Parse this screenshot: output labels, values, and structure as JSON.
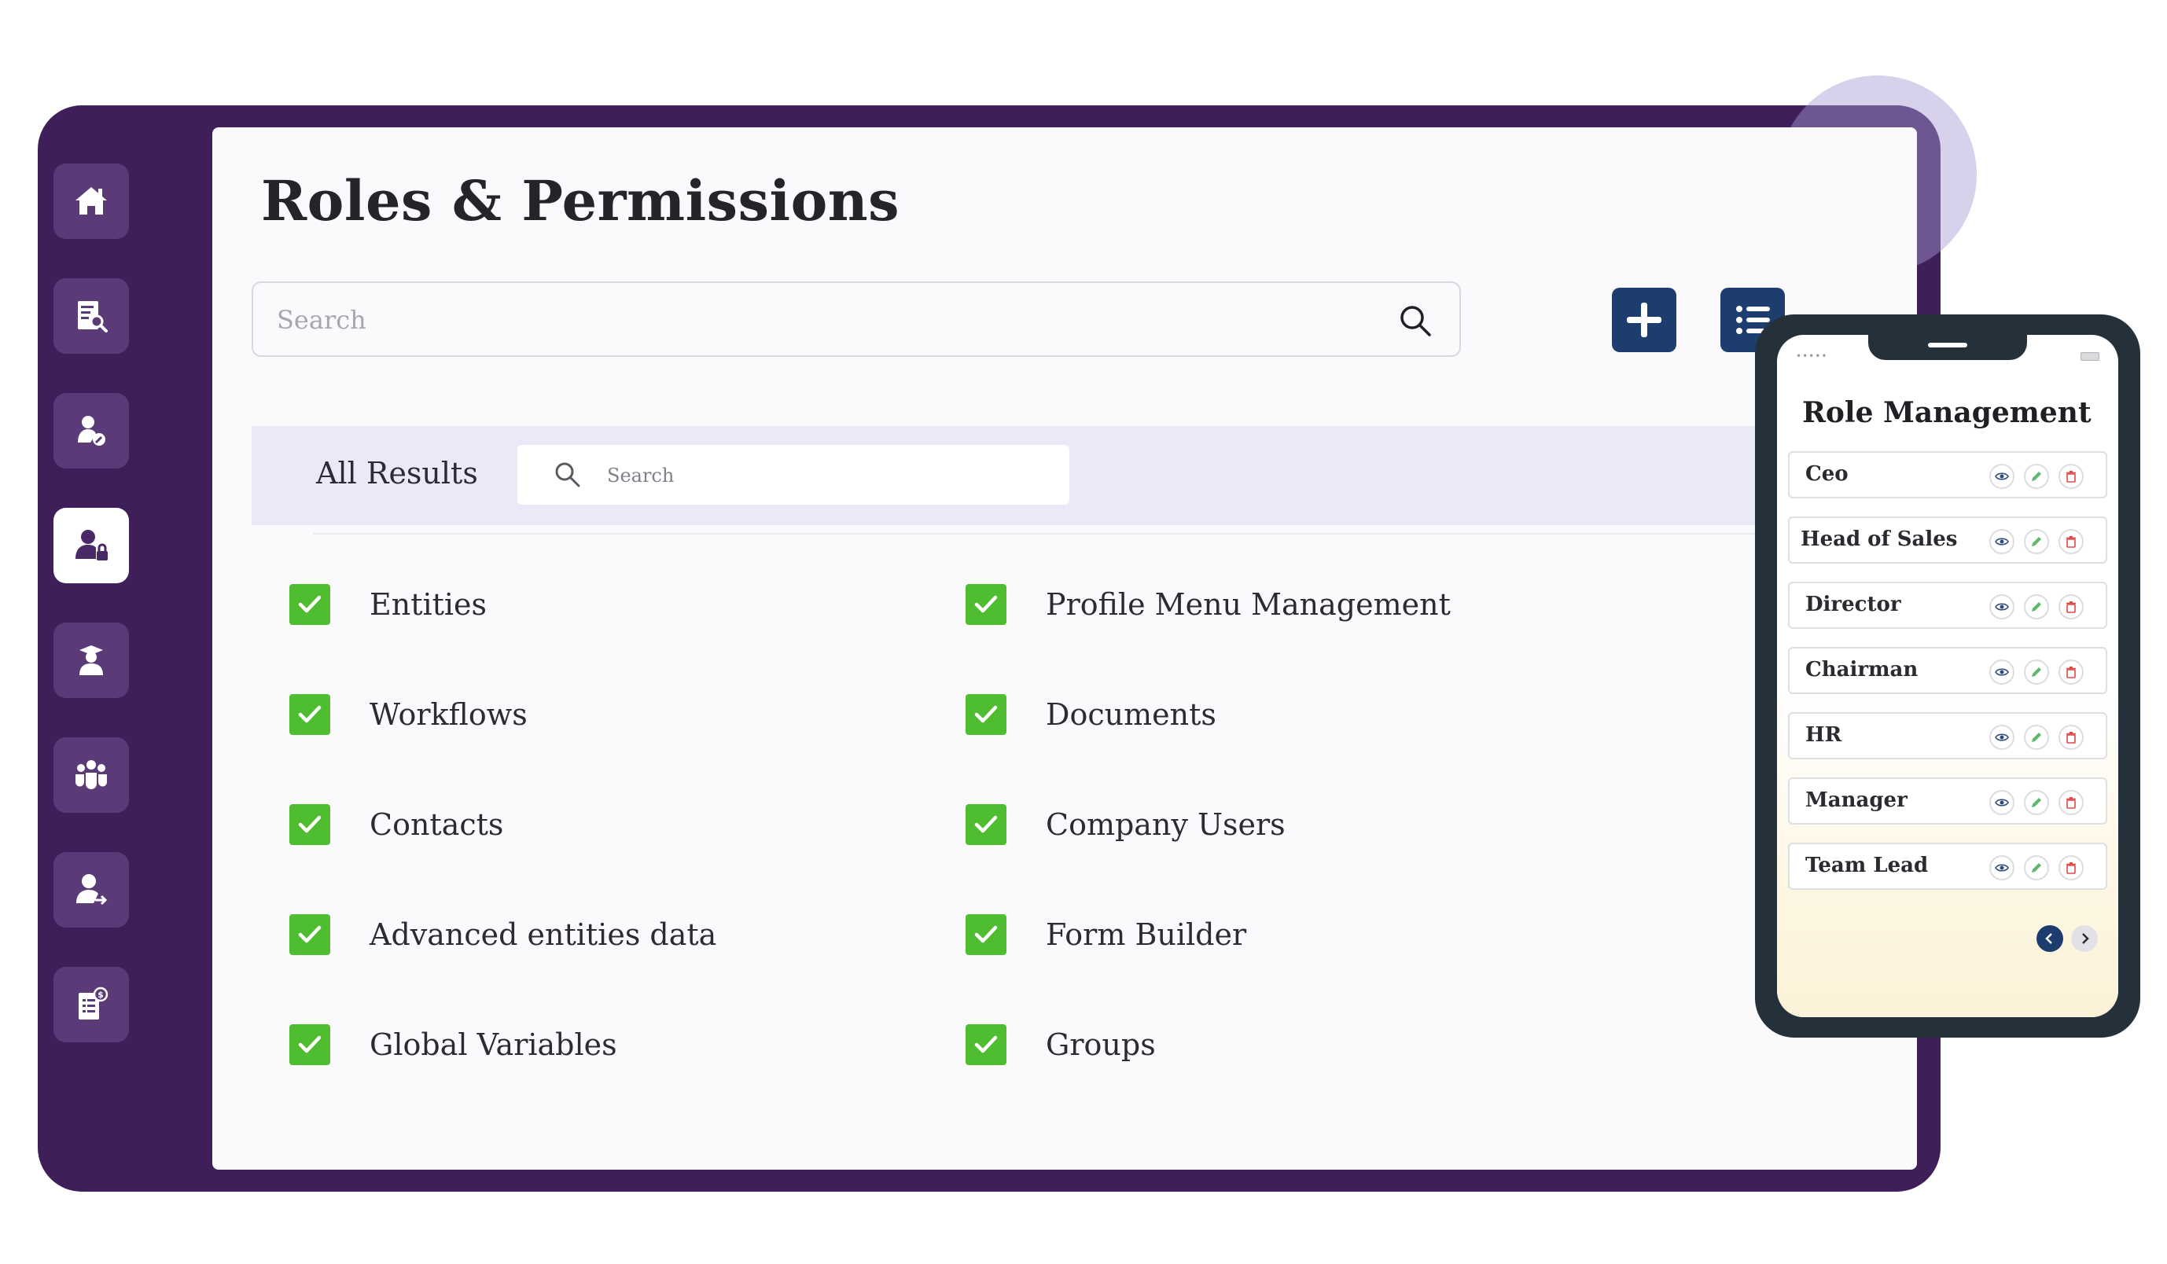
{
  "app": {
    "title": "Roles & Permissions"
  },
  "sidebar": {
    "items": [
      {
        "name": "home",
        "icon": "home-icon",
        "active": false
      },
      {
        "name": "document-search",
        "icon": "document-search-icon",
        "active": false
      },
      {
        "name": "user-settings",
        "icon": "user-edit-icon",
        "active": false
      },
      {
        "name": "user-permissions",
        "icon": "user-lock-icon",
        "active": true
      },
      {
        "name": "graduate",
        "icon": "graduate-icon",
        "active": false
      },
      {
        "name": "team",
        "icon": "team-icon",
        "active": false
      },
      {
        "name": "user-transfer",
        "icon": "user-arrow-icon",
        "active": false
      },
      {
        "name": "billing",
        "icon": "invoice-dollar-icon",
        "active": false
      }
    ]
  },
  "search": {
    "placeholder": "Search",
    "value": ""
  },
  "toolbar": {
    "add_icon": "plus-icon",
    "list_icon": "list-icon"
  },
  "results": {
    "label": "All Results",
    "search_placeholder": "Search"
  },
  "permissions": [
    {
      "label": "Entities",
      "checked": true
    },
    {
      "label": "Workflows",
      "checked": true
    },
    {
      "label": "Contacts",
      "checked": true
    },
    {
      "label": "Advanced entities data",
      "checked": true
    },
    {
      "label": "Global Variables",
      "checked": true
    },
    {
      "label": "Profile Menu Management",
      "checked": true
    },
    {
      "label": "Documents",
      "checked": true
    },
    {
      "label": "Company Users",
      "checked": true
    },
    {
      "label": "Form Builder",
      "checked": true
    },
    {
      "label": "Groups",
      "checked": true
    }
  ],
  "phone": {
    "title": "Role Management",
    "roles": [
      {
        "name": "Ceo"
      },
      {
        "name": "Head of Sales"
      },
      {
        "name": "Director"
      },
      {
        "name": "Chairman"
      },
      {
        "name": "HR"
      },
      {
        "name": "Manager"
      },
      {
        "name": "Team Lead"
      }
    ],
    "pager": {
      "prev_icon": "chevron-left-icon",
      "next_icon": "chevron-right-icon"
    }
  },
  "colors": {
    "frame": "#3e1f5a",
    "sidebar_button": "#5a3b78",
    "accent_button": "#1c3d6e",
    "check": "#4ebd2f",
    "results_bar": "#ebe8f8",
    "phone_body": "#25313a"
  }
}
